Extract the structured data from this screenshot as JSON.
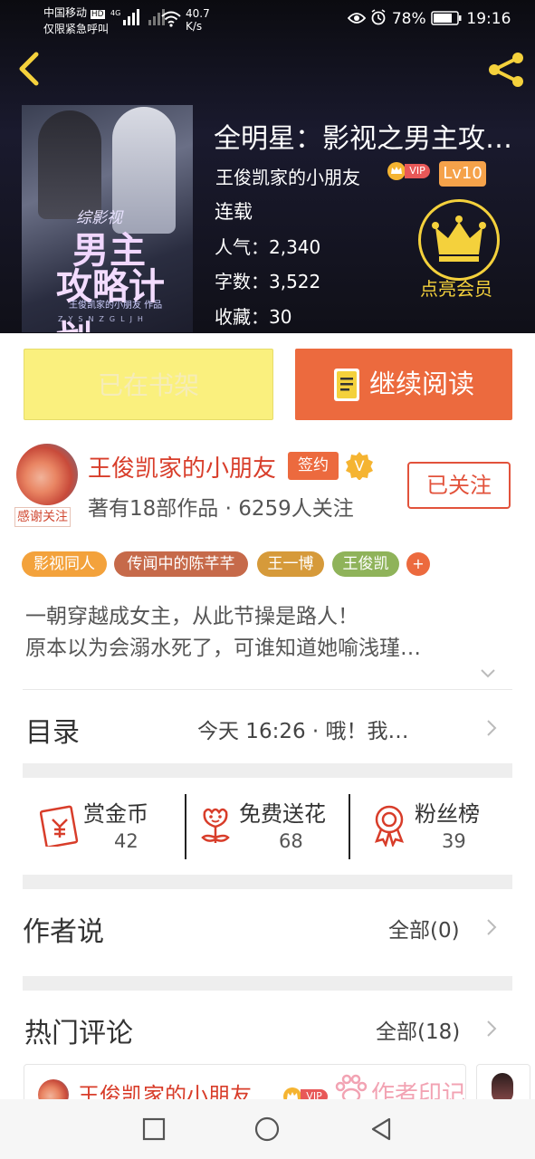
{
  "status_bar": {
    "carrier_line1": "中国移动",
    "carrier_badge": "HD",
    "carrier_line2": "仅限紧急呼叫",
    "network": "4G",
    "speed_value": "40.7",
    "speed_unit": "K/s",
    "battery": "78%",
    "time": "19:16",
    "icons": [
      "eye-icon",
      "alarm-icon",
      "battery-icon",
      "wifi-icon",
      "signal-icon"
    ]
  },
  "header": {
    "back_icon": "chevron-left-icon",
    "share_icon": "share-icon"
  },
  "book": {
    "cover_text_small": "综影视",
    "cover_text_line1": "男主",
    "cover_text_line2": "攻略计划",
    "cover_author": "王俊凯家的小朋友 作品",
    "cover_pinyin": "ZYSNZGLJH",
    "title": "全明星：影视之男主攻…",
    "author": "王俊凯家的小朋友",
    "vip_label": "VIP",
    "level": "Lv10",
    "status": "连载",
    "popularity_label": "人气：",
    "popularity": "2,340",
    "word_count_label": "字数：",
    "word_count": "3,522",
    "favorites_label": "收藏：",
    "favorites": "30",
    "member_label": "点亮会员"
  },
  "actions": {
    "shelf_label": "已在书架",
    "read_label": "继续阅读"
  },
  "author_card": {
    "name": "王俊凯家的小朋友",
    "signed_label": "签约",
    "verified_label": "V",
    "info": "著有18部作品 · 6259人关注",
    "thanks_label": "感谢关注",
    "follow_label": "已关注"
  },
  "tags": [
    {
      "label": "影视同人",
      "color": "#f3a23c"
    },
    {
      "label": "传闻中的陈芊芊",
      "color": "#c66a4a"
    },
    {
      "label": "王一博",
      "color": "#d69a3a"
    },
    {
      "label": "王俊凯",
      "color": "#8fb35a"
    }
  ],
  "tag_more": "+",
  "description": {
    "line1": "一朝穿越成女主，从此节操是路人！",
    "line2": "原本以为会溺水死了，可谁知道她喻浅瑾…"
  },
  "catalog": {
    "label": "目录",
    "latest": "今天 16:26 · 哦！我…"
  },
  "gifts": [
    {
      "label": "赏金币",
      "count": "42",
      "icon": "coin-envelope-icon"
    },
    {
      "label": "免费送花",
      "count": "68",
      "icon": "flower-icon"
    },
    {
      "label": "粉丝榜",
      "count": "39",
      "icon": "medal-icon"
    }
  ],
  "author_says": {
    "label": "作者说",
    "link": "全部(0)"
  },
  "hot_comments": {
    "label": "热门评论",
    "link": "全部(18)",
    "first_name": "王俊凯家的小朋友",
    "first_vip": "VIP",
    "first_stamp": "作者印记"
  },
  "nav": {
    "icons": [
      "recent-apps-icon",
      "home-icon",
      "back-icon"
    ]
  },
  "colors": {
    "accent": "#ec6a3e",
    "author_red": "#d83d2a",
    "gold": "#f4d13c",
    "shelf_yellow": "#faf07e"
  }
}
